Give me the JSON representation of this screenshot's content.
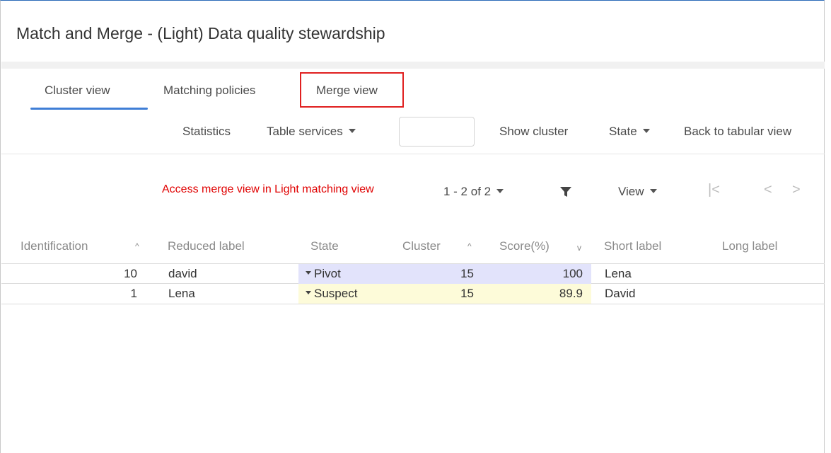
{
  "window": {
    "title": "Match and Merge - (Light) Data quality stewardship"
  },
  "tabs": [
    {
      "label": "Cluster view",
      "active": true
    },
    {
      "label": "Matching policies",
      "active": false
    },
    {
      "label": "Merge view",
      "active": false,
      "highlighted": true
    }
  ],
  "toolbar": {
    "statistics": "Statistics",
    "table_services": "Table services",
    "search_value": "",
    "show_cluster": "Show cluster",
    "state": "State",
    "back": "Back to tabular view"
  },
  "annotation": "Access merge view in Light matching view",
  "pager": {
    "range": "1 - 2 of 2",
    "view": "View",
    "first_icon": "first-page-icon",
    "prev_icon": "prev-page-icon",
    "next_icon": "next-page-icon",
    "filter_icon": "filter-icon"
  },
  "table": {
    "columns": {
      "identification": "Identification",
      "reduced_label": "Reduced label",
      "state": "State",
      "cluster": "Cluster",
      "score": "Score(%)",
      "short_label": "Short label",
      "long_label": "Long label"
    },
    "rows": [
      {
        "identification": "10",
        "reduced_label": "david",
        "state": "Pivot",
        "cluster": "15",
        "score": "100",
        "short_label": "Lena",
        "long_label": ""
      },
      {
        "identification": "1",
        "reduced_label": "Lena",
        "state": "Suspect",
        "cluster": "15",
        "score": "89.9",
        "short_label": "David",
        "long_label": ""
      }
    ]
  },
  "colors": {
    "accent": "#3f7ed6",
    "annotation": "#e00000",
    "pivot_bg": "#e2e3fb",
    "suspect_bg": "#fdfbd9"
  }
}
